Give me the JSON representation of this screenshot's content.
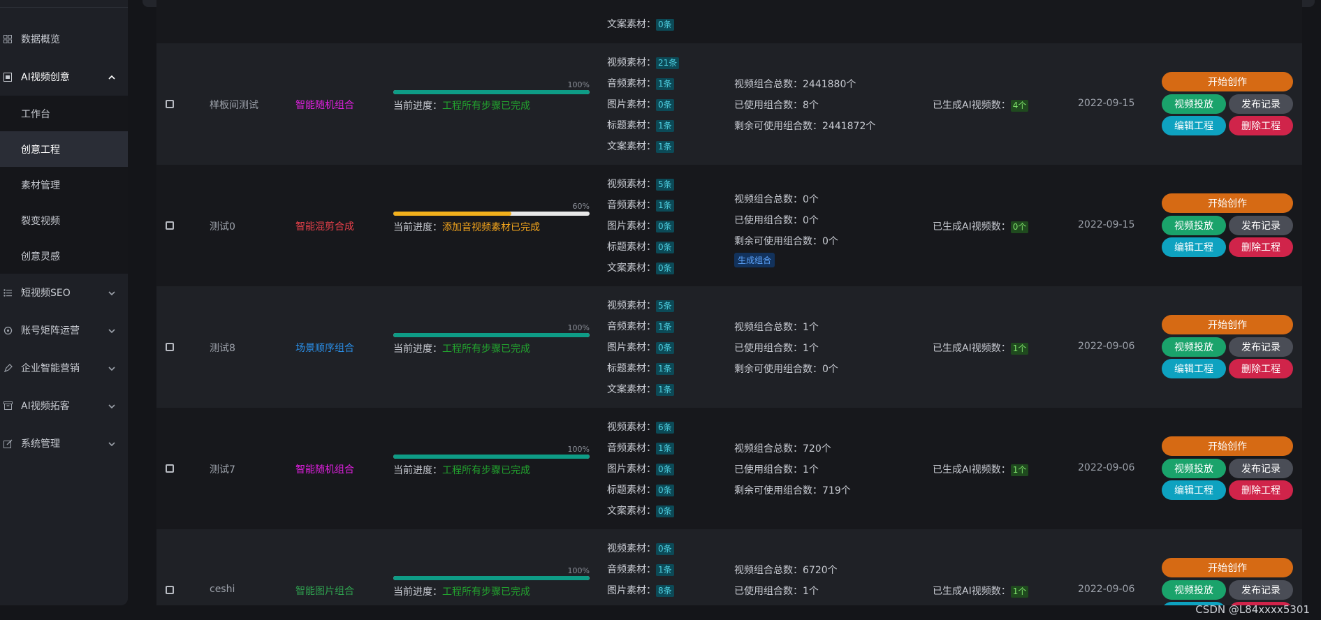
{
  "sidebar": {
    "items": [
      {
        "label": "数据概览",
        "icon": "dashboard-icon"
      },
      {
        "label": "AI视频创意",
        "icon": "ai-video-icon"
      },
      {
        "label": "短视频SEO",
        "icon": "list-icon"
      },
      {
        "label": "账号矩阵运营",
        "icon": "matrix-icon"
      },
      {
        "label": "企业智能营销",
        "icon": "pen-icon"
      },
      {
        "label": "AI视频拓客",
        "icon": "box-icon"
      },
      {
        "label": "系统管理",
        "icon": "edit-icon"
      }
    ],
    "sub_items": [
      {
        "label": "工作台"
      },
      {
        "label": "创意工程"
      },
      {
        "label": "素材管理"
      },
      {
        "label": "裂变视频"
      },
      {
        "label": "创意灵感"
      }
    ]
  },
  "labels": {
    "video_mat": "视频素材：",
    "audio_mat": "音频素材：",
    "image_mat": "图片素材：",
    "title_mat": "标题素材：",
    "copy_mat": "文案素材：",
    "progress_prefix": "当前进度：",
    "combo_total": "视频组合总数：",
    "combo_used": "已使用组合数：",
    "combo_left": "剩余可使用组合数：",
    "ai_generated": "已生成AI视频数：",
    "btn_start": "开始创作",
    "btn_deliver": "视频投放",
    "btn_publish_log": "发布记录",
    "btn_edit": "编辑工程",
    "btn_delete": "删除工程",
    "btn_generate": "生成组合"
  },
  "top_partial": {
    "copy": "0条"
  },
  "rows": [
    {
      "name": "样板间测试",
      "type": "智能随机组合",
      "type_color": "#e020e0",
      "pct": "100%",
      "progress": 1.0,
      "progress_color": "#0e9c86",
      "status": "工程所有步骤已完成",
      "status_color": "#22a32e",
      "video": "21条",
      "audio": "1条",
      "image": "0条",
      "title": "1条",
      "copy": "1条",
      "total": "2441880个",
      "used": "8个",
      "left": "2441872个",
      "ai": "4个",
      "date": "2022-09-15"
    },
    {
      "name": "测试0",
      "type": "智能混剪合成",
      "type_color": "#e8404a",
      "pct": "60%",
      "progress": 0.6,
      "progress_color": "#f2b01c",
      "status": "添加音视频素材已完成",
      "status_color": "#f2a41c",
      "video": "5条",
      "audio": "1条",
      "image": "0条",
      "title": "0条",
      "copy": "0条",
      "total": "0个",
      "used": "0个",
      "left": "0个",
      "ai": "0个",
      "date": "2022-09-15"
    },
    {
      "name": "测试8",
      "type": "场景顺序组合",
      "type_color": "#2a8fe8",
      "pct": "100%",
      "progress": 1.0,
      "progress_color": "#0e9c86",
      "status": "工程所有步骤已完成",
      "status_color": "#22a32e",
      "video": "5条",
      "audio": "1条",
      "image": "0条",
      "title": "1条",
      "copy": "1条",
      "total": "1个",
      "used": "1个",
      "left": "0个",
      "ai": "1个",
      "date": "2022-09-06"
    },
    {
      "name": "测试7",
      "type": "智能随机组合",
      "type_color": "#e020e0",
      "pct": "100%",
      "progress": 1.0,
      "progress_color": "#0e9c86",
      "status": "工程所有步骤已完成",
      "status_color": "#22a32e",
      "video": "6条",
      "audio": "1条",
      "image": "0条",
      "title": "0条",
      "copy": "0条",
      "total": "720个",
      "used": "1个",
      "left": "719个",
      "ai": "1个",
      "date": "2022-09-06"
    },
    {
      "name": "ceshi",
      "type": "智能图片组合",
      "type_color": "#2fa14f",
      "pct": "100%",
      "progress": 1.0,
      "progress_color": "#0e9c86",
      "status": "工程所有步骤已完成",
      "status_color": "#22a32e",
      "video": "0条",
      "audio": "1条",
      "image": "8条",
      "title": "",
      "copy": "",
      "total": "6720个",
      "used": "1个",
      "left": "",
      "ai": "1个",
      "date": "2022-09-06"
    }
  ],
  "watermark": "CSDN @L84xxxx5301"
}
